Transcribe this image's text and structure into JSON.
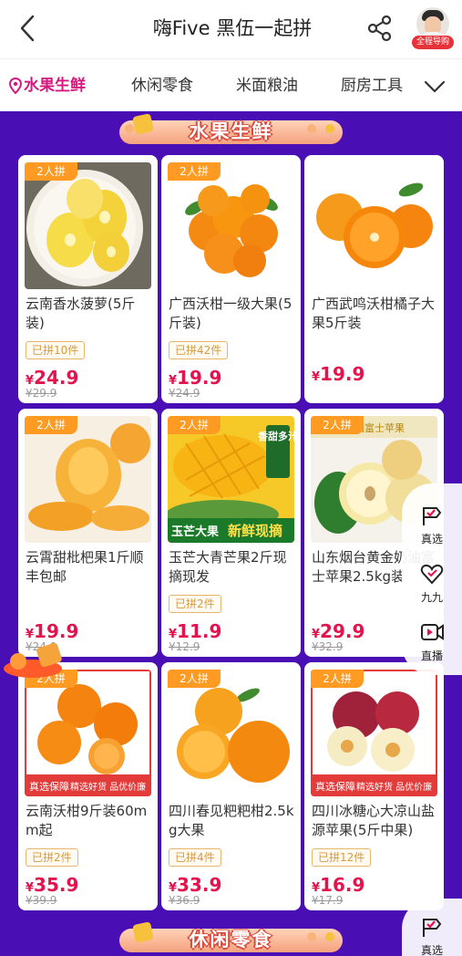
{
  "header": {
    "title": "嗨Five 黑伍一起拼",
    "avatar_badge": "全程导购"
  },
  "tabs": [
    {
      "label": "水果生鲜",
      "active": true
    },
    {
      "label": "休闲零食",
      "active": false
    },
    {
      "label": "米面粮油",
      "active": false
    },
    {
      "label": "厨房工具",
      "active": false
    }
  ],
  "sections": {
    "fruit": "水果生鲜",
    "snacks": "休闲零食"
  },
  "products": [
    {
      "tag": "2人拼",
      "name": "云南香水菠萝(5斤装)",
      "sold": "已拼10件",
      "yen": "¥",
      "price": "24.9",
      "orig": "¥29.9"
    },
    {
      "tag": "2人拼",
      "name": "广西沃柑一级大果(5斤装)",
      "sold": "已拼42件",
      "yen": "¥",
      "price": "19.9",
      "orig": "¥24.9"
    },
    {
      "tag": "",
      "name": "广西武鸣沃柑橘子大果5斤装",
      "sold": "",
      "yen": "¥",
      "price": "19.9",
      "orig": ""
    },
    {
      "tag": "2人拼",
      "name": "云霄甜枇杷果1斤顺丰包邮",
      "sold": "",
      "yen": "¥",
      "price": "19.9",
      "orig": "¥24.9"
    },
    {
      "tag": "2人拼",
      "name": "玉芒大青芒果2斤现摘现发",
      "sold": "已拼2件",
      "yen": "¥",
      "price": "11.9",
      "orig": "¥12.9",
      "img_text_1": "香甜多汁",
      "img_text_2": "玉芒大果",
      "img_text_3": "新鲜现摘"
    },
    {
      "tag": "2人拼",
      "name": "山东烟台黄金奶油富士苹果2.5kg装",
      "sold": "",
      "yen": "¥",
      "price": "29.9",
      "orig": "¥32.9",
      "img_text_1": "奶油富士苹果"
    },
    {
      "tag": "2人拼",
      "name": "云南沃柑9斤装60mm起",
      "sold": "已拼2件",
      "yen": "¥",
      "price": "35.9",
      "orig": "¥39.9",
      "img_band_1": "真选保障",
      "img_band_2": "精选好货 品优价廉"
    },
    {
      "tag": "2人拼",
      "name": "四川春见粑粑柑2.5kg大果",
      "sold": "已拼4件",
      "yen": "¥",
      "price": "33.9",
      "orig": "¥36.9"
    },
    {
      "tag": "2人拼",
      "name": "四川冰糖心大凉山盐源苹果(5斤中果)",
      "sold": "已拼12件",
      "yen": "¥",
      "price": "16.9",
      "orig": "¥17.9",
      "img_band_1": "真选保障",
      "img_band_2": "精选好货 品优价廉"
    }
  ],
  "float_menu": [
    {
      "label": "真选",
      "icon": "check-flag-icon"
    },
    {
      "label": "九九",
      "icon": "heart-nine-icon"
    },
    {
      "label": "直播",
      "icon": "live-video-icon"
    }
  ],
  "bottom_float": {
    "label": "真选",
    "icon": "check-flag-icon"
  },
  "colors": {
    "accent_purple": "#4a0fb4",
    "active_tab": "#d6197f",
    "price_red": "#e4134d",
    "group_tag_orange": "#ff9b22"
  }
}
